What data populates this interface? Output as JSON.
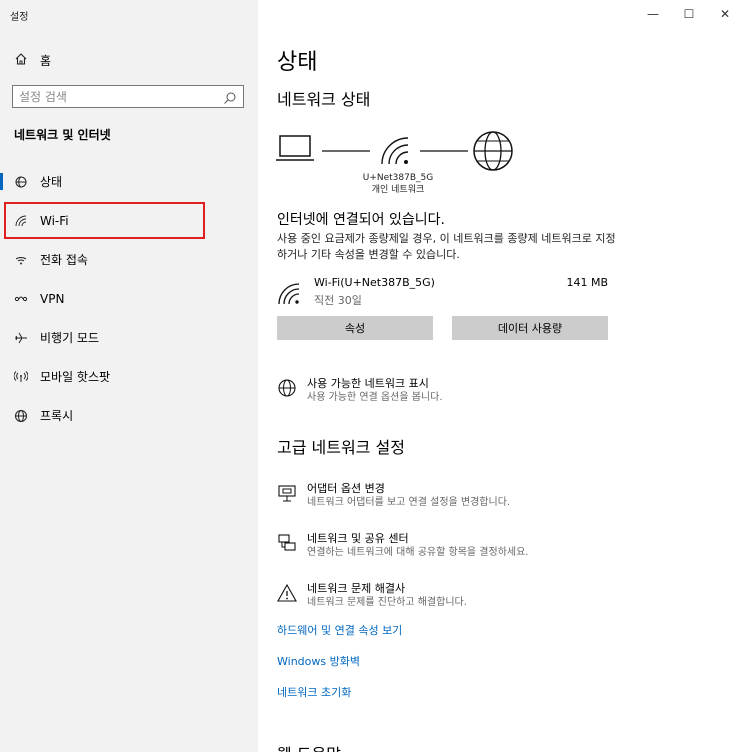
{
  "app": {
    "title": "설정"
  },
  "window_controls": {
    "minimize": "—",
    "maximize": "☐",
    "close": "✕"
  },
  "sidebar": {
    "home_label": "홈",
    "search_placeholder": "설정 검색",
    "section_title": "네트워크 및 인터넷",
    "items": [
      {
        "label": "상태",
        "icon": "status-icon"
      },
      {
        "label": "Wi-Fi",
        "icon": "wifi-icon"
      },
      {
        "label": "전화 접속",
        "icon": "dialup-icon"
      },
      {
        "label": "VPN",
        "icon": "vpn-icon"
      },
      {
        "label": "비행기 모드",
        "icon": "airplane-icon"
      },
      {
        "label": "모바일 핫스팟",
        "icon": "hotspot-icon"
      },
      {
        "label": "프록시",
        "icon": "globe-icon"
      }
    ],
    "active_index": 0,
    "highlight_color": "#e02020"
  },
  "main": {
    "page_title": "상태",
    "network_status_title": "네트워크 상태",
    "diagram_network_name": "U+Net387B_5G",
    "diagram_network_type": "개인 네트워크",
    "connected_title": "인터넷에 연결되어 있습니다.",
    "connected_desc": "사용 중인 요금제가 종량제일 경우, 이 네트워크를 종량제 네트워크로 지정하거나 기타 속성을 변경할 수 있습니다.",
    "connection": {
      "name": "Wi-Fi(U+Net387B_5G)",
      "sub": "직전 30일",
      "usage": "141 MB"
    },
    "buttons": {
      "properties": "속성",
      "data_usage": "데이터 사용량"
    },
    "available_networks": {
      "title": "사용 가능한 네트워크 표시",
      "desc": "사용 가능한 연결 옵션을 봅니다."
    },
    "advanced_title": "고급 네트워크 설정",
    "advanced_items": [
      {
        "title": "어댑터 옵션 변경",
        "desc": "네트워크 어댑터를 보고 연결 설정을 변경합니다."
      },
      {
        "title": "네트워크 및 공유 센터",
        "desc": "연결하는 네트워크에 대해 공유할 항목을 결정하세요."
      },
      {
        "title": "네트워크 문제 해결사",
        "desc": "네트워크 문제를 진단하고 해결합니다."
      }
    ],
    "links": {
      "hardware": "하드웨어 및 연결 속성 보기",
      "firewall": "Windows 방화벽",
      "reset": "네트워크 초기화"
    },
    "cut_off_heading": "웹 도움말"
  },
  "colors": {
    "accent": "#0067c0",
    "sidebar_bg": "#f2f2f2",
    "button_bg": "#cccccc"
  }
}
